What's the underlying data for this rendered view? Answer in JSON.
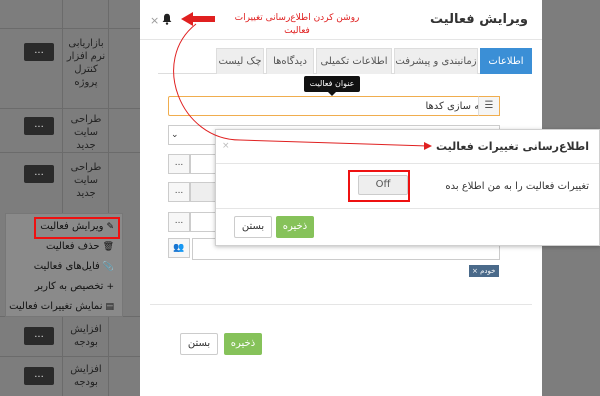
{
  "background": {
    "rows": [
      {
        "text": "بازاریابی نرم افزار کنترل پروژه",
        "btn": "..."
      },
      {
        "text": "طراحی سایت جدید",
        "btn": "..."
      },
      {
        "text": "طراحی سایت جدید",
        "btn": "..."
      },
      {
        "text": "افزایش بودجه",
        "btn": "..."
      },
      {
        "text": "افزایش بودجه",
        "btn": "..."
      }
    ],
    "context_menu": [
      {
        "label": "ویرایش فعالیت",
        "icon": "edit-icon"
      },
      {
        "label": "حذف فعالیت",
        "icon": "trash-icon"
      },
      {
        "label": "فایل‌های فعالیت",
        "icon": "paperclip-icon"
      },
      {
        "label": "تخصیص به کاربر",
        "icon": "user-plus-icon"
      },
      {
        "label": "نمایش تغییرات فعالیت",
        "icon": "list-icon"
      }
    ]
  },
  "modal": {
    "title": "ویرایش فعالیت",
    "annotation": "روشن کردن اطلاع‌رسانی تغییرات فعالیت",
    "tabs": [
      {
        "label": "اطلاعات اصلی",
        "active": true
      },
      {
        "label": "زمانبندی و پیشرفت",
        "active": false
      },
      {
        "label": "اطلاعات تکمیلی",
        "active": false
      },
      {
        "label": "دیدگاه‌ها",
        "active": false
      },
      {
        "label": "چک لیست",
        "active": false
      }
    ],
    "tooltip": "عنوان فعالیت",
    "title_value": "بهینه سازی کدها",
    "dots_label": "...",
    "tag": "خودم ×",
    "save_label": "ذخیره",
    "close_label": "بستن"
  },
  "popup": {
    "title": "اطلاع‌رسانی تغییرات فعالیت",
    "label": "تغییرات فعالیت را به من اطلاع بده",
    "toggle": "Off",
    "save_label": "ذخیره",
    "close_label": "بستن"
  },
  "colors": {
    "accent": "#3b8fd6",
    "save": "#86c25a",
    "annotation": "#e02020"
  }
}
